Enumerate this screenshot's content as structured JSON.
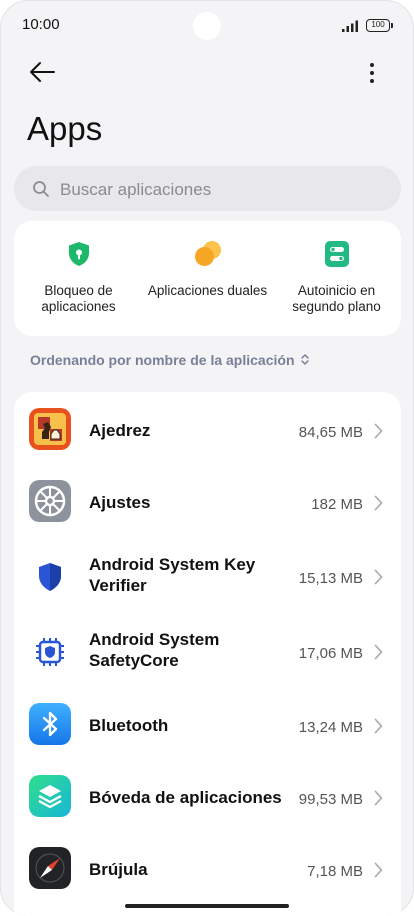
{
  "status_bar": {
    "time": "10:00",
    "battery": "100",
    "signal_icon": "signal-bars-icon"
  },
  "header": {
    "back_icon": "arrow-left-icon",
    "more_icon": "more-vertical-icon",
    "title": "Apps"
  },
  "search": {
    "placeholder": "Buscar aplicaciones",
    "value": "",
    "icon": "search-icon"
  },
  "quick_actions": [
    {
      "label": "Bloqueo de aplicaciones",
      "icon": "shield-lock-icon",
      "color": "#1db86a"
    },
    {
      "label": "Aplicaciones duales",
      "icon": "dual-circles-icon",
      "color": "#f5a623"
    },
    {
      "label": "Autoinicio en segundo plano",
      "icon": "toggle-switches-icon",
      "color": "#22b983"
    }
  ],
  "sort": {
    "label": "Ordenando por nombre de la aplicación",
    "icon": "sort-updown-icon"
  },
  "apps": [
    {
      "name": "Ajedrez",
      "size": "84,65 MB",
      "icon": "chess-icon"
    },
    {
      "name": "Ajustes",
      "size": "182 MB",
      "icon": "settings-gear-icon"
    },
    {
      "name": "Android System Key Verifier",
      "size": "15,13 MB",
      "icon": "key-verifier-shield-icon"
    },
    {
      "name": "Android System SafetyCore",
      "size": "17,06 MB",
      "icon": "safetycore-chip-icon"
    },
    {
      "name": "Bluetooth",
      "size": "13,24 MB",
      "icon": "bluetooth-icon"
    },
    {
      "name": "Bóveda de aplicaciones",
      "size": "99,53 MB",
      "icon": "app-vault-layers-icon"
    },
    {
      "name": "Brújula",
      "size": "7,18 MB",
      "icon": "compass-icon"
    }
  ]
}
